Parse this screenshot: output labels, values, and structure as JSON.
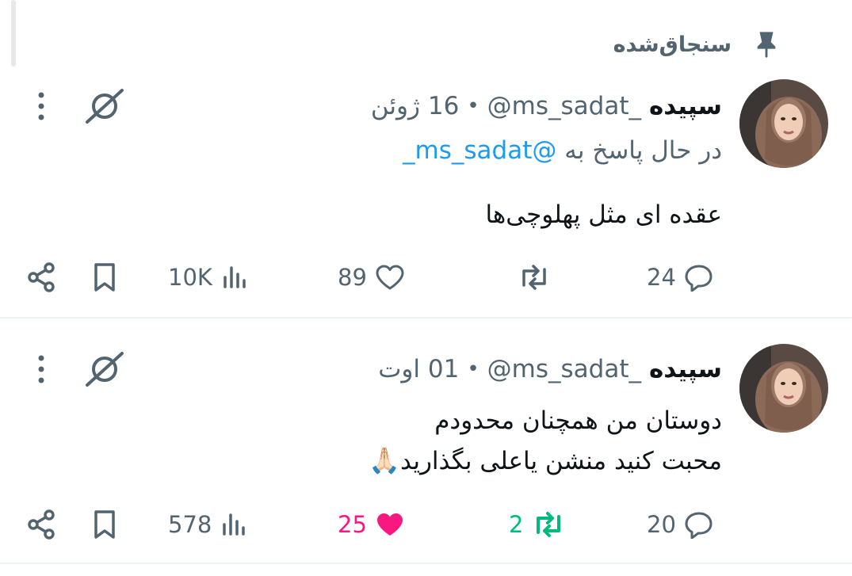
{
  "pinned": {
    "label": "سنجاق‌شده",
    "icon": "pin-icon"
  },
  "tweets": [
    {
      "name": "سپیده",
      "handle": "@ms_sadat_",
      "separator": "•",
      "date": "16 ژوئن",
      "reply_prefix": "در حال پاسخ به",
      "reply_handle": "@ms_sadat_",
      "lines": [
        "عقده ای مثل پهلوچی‌ها"
      ],
      "stats": {
        "views": "10K",
        "likes": "89",
        "retweets": "",
        "replies": "24"
      },
      "liked": false,
      "retweeted": false
    },
    {
      "name": "سپیده",
      "handle": "@ms_sadat_",
      "separator": "•",
      "date": "01 اوت",
      "lines": [
        "دوستان من همچنان محدودم",
        "محبت کنید منشن یاعلی بگذارید"
      ],
      "emoji": "🙏🏻",
      "stats": {
        "views": "578",
        "likes": "25",
        "retweets": "2",
        "replies": "20"
      },
      "liked": true,
      "retweeted": true
    }
  ],
  "colors": {
    "text": "#0f1419",
    "secondary": "#536471",
    "link": "#1d9bf0",
    "like": "#f91880",
    "retweet": "#00ba7c",
    "divider": "#eff3f4"
  }
}
